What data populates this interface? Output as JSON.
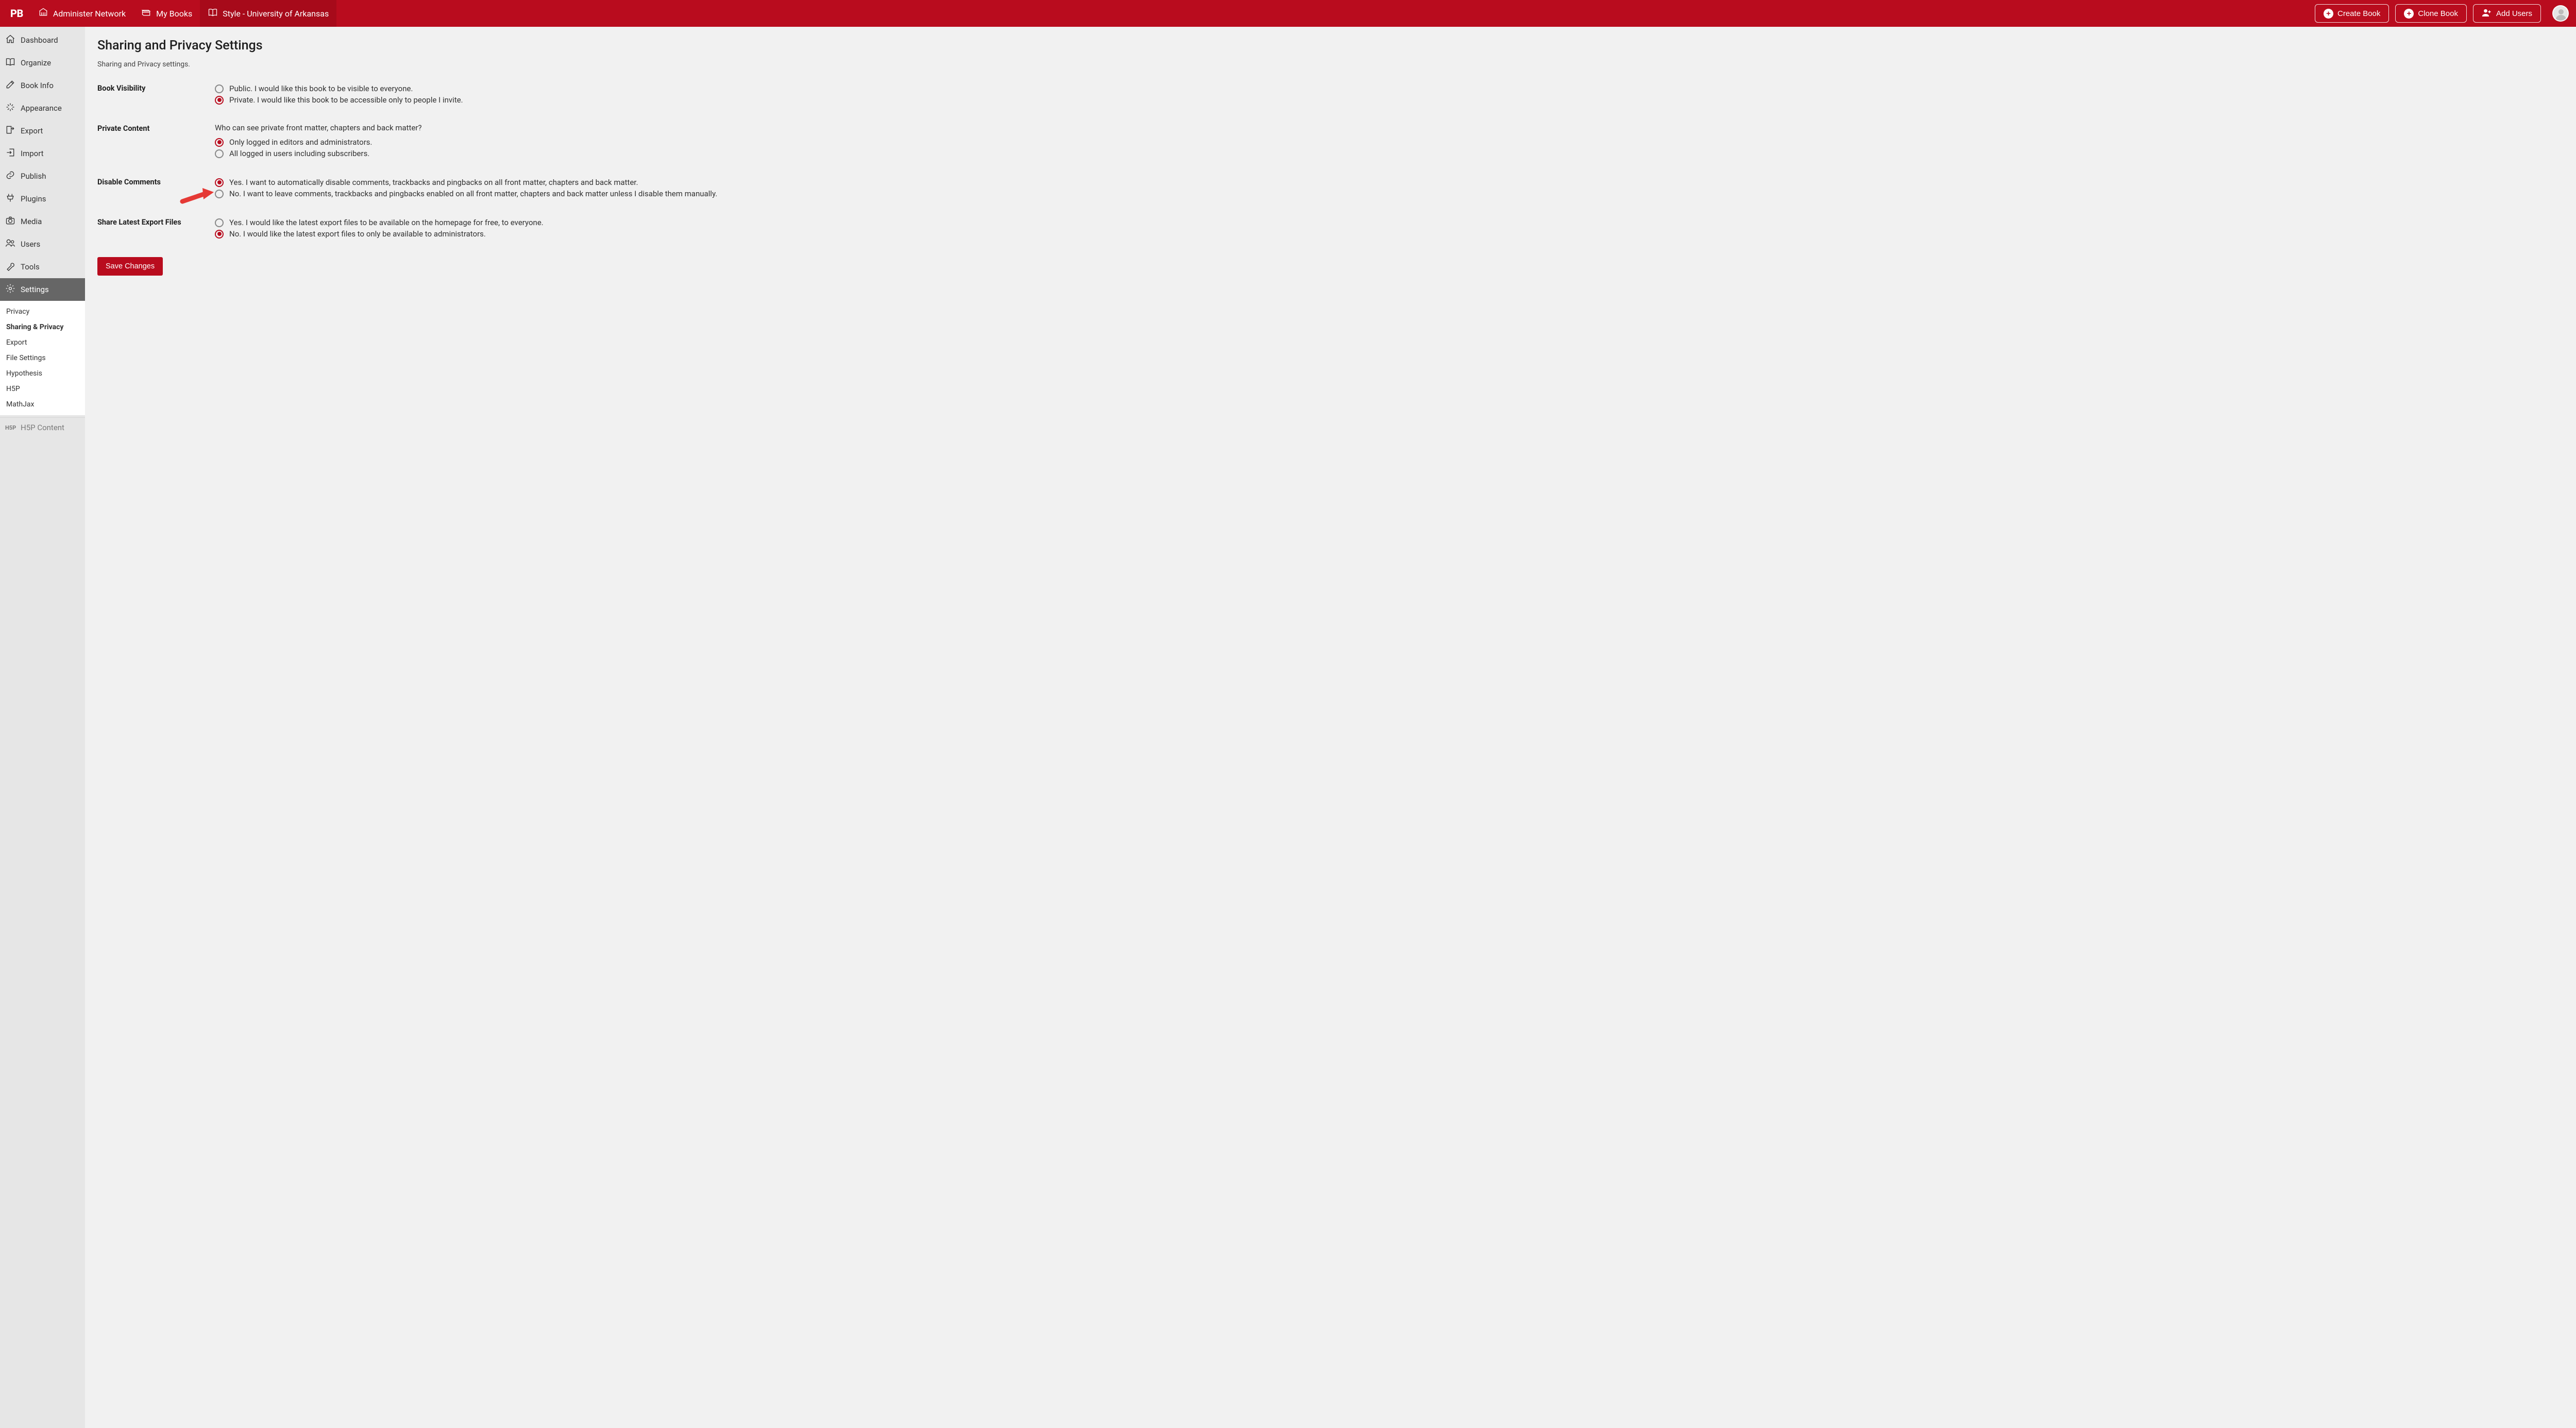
{
  "brand": "PB",
  "colors": {
    "accent": "#b90c1e"
  },
  "topbar": {
    "items": [
      {
        "label": "Administer Network"
      },
      {
        "label": "My Books"
      },
      {
        "label": "Style - University of Arkansas",
        "active": true
      }
    ],
    "buttons": {
      "create_book": "Create Book",
      "clone_book": "Clone Book",
      "add_users": "Add Users"
    }
  },
  "sidebar": {
    "items": [
      {
        "label": "Dashboard"
      },
      {
        "label": "Organize"
      },
      {
        "label": "Book Info"
      },
      {
        "label": "Appearance"
      },
      {
        "label": "Export"
      },
      {
        "label": "Import"
      },
      {
        "label": "Publish"
      },
      {
        "label": "Plugins"
      },
      {
        "label": "Media"
      },
      {
        "label": "Users"
      },
      {
        "label": "Tools"
      },
      {
        "label": "Settings",
        "active": true
      }
    ],
    "settings_submenu": [
      {
        "label": "Privacy"
      },
      {
        "label": "Sharing & Privacy",
        "active": true
      },
      {
        "label": "Export"
      },
      {
        "label": "File Settings"
      },
      {
        "label": "Hypothesis"
      },
      {
        "label": "H5P"
      },
      {
        "label": "MathJax"
      }
    ],
    "collapse_label": "H5P Content"
  },
  "page": {
    "title": "Sharing and Privacy Settings",
    "description": "Sharing and Privacy settings."
  },
  "sections": {
    "visibility": {
      "label": "Book Visibility",
      "opt_public": "Public. I would like this book to be visible to everyone.",
      "opt_private": "Private. I would like this book to be accessible only to people I invite."
    },
    "private_content": {
      "label": "Private Content",
      "helper": "Who can see private front matter, chapters and back matter?",
      "opt_editors": "Only logged in editors and administrators.",
      "opt_all": "All logged in users including subscribers."
    },
    "disable_comments": {
      "label": "Disable Comments",
      "opt_yes": "Yes. I want to automatically disable comments, trackbacks and pingbacks on all front matter, chapters and back matter.",
      "opt_no": "No. I want to leave comments, trackbacks and pingbacks enabled on all front matter, chapters and back matter unless I disable them manually."
    },
    "share_exports": {
      "label": "Share Latest Export Files",
      "opt_yes": "Yes. I would like the latest export files to be available on the homepage for free, to everyone.",
      "opt_no": "No. I would like the latest export files to only be available to administrators."
    }
  },
  "save_label": "Save Changes"
}
